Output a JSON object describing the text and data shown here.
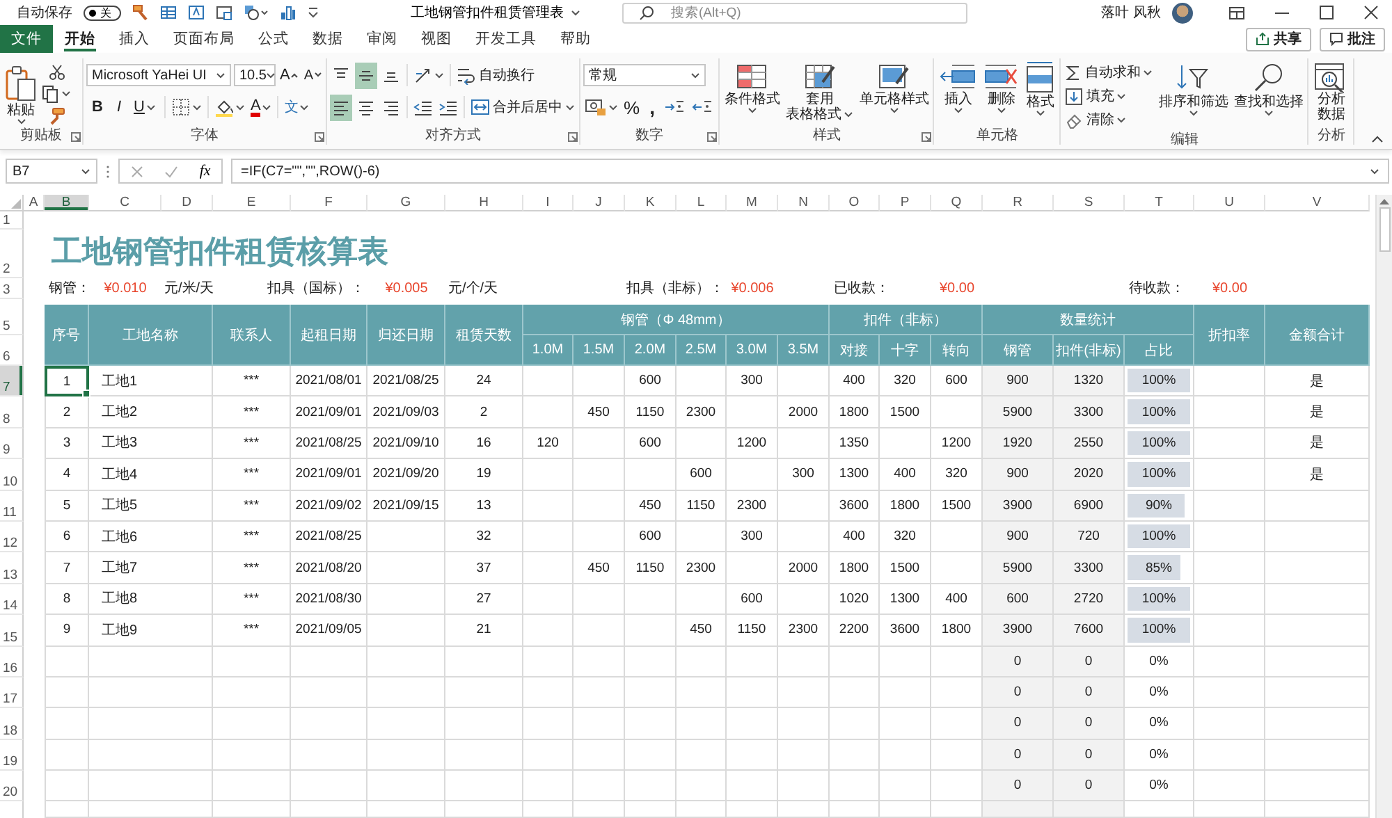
{
  "title_bar": {
    "autosave_label": "自动保存",
    "autosave_toggle": {
      "label": "关",
      "on": false
    },
    "document_title": "工地钢管扣件租赁管理表",
    "search": {
      "placeholder": "搜索(Alt+Q)"
    },
    "user_name": "落叶 风秋"
  },
  "ribbon_tabs": [
    {
      "label": "文件",
      "kind": "file",
      "selected": false
    },
    {
      "label": "开始",
      "kind": "tab",
      "selected": true
    },
    {
      "label": "插入",
      "kind": "tab",
      "selected": false
    },
    {
      "label": "页面布局",
      "kind": "tab",
      "selected": false
    },
    {
      "label": "公式",
      "kind": "tab",
      "selected": false
    },
    {
      "label": "数据",
      "kind": "tab",
      "selected": false
    },
    {
      "label": "审阅",
      "kind": "tab",
      "selected": false
    },
    {
      "label": "视图",
      "kind": "tab",
      "selected": false
    },
    {
      "label": "开发工具",
      "kind": "tab",
      "selected": false
    },
    {
      "label": "帮助",
      "kind": "tab",
      "selected": false
    }
  ],
  "share_button": "共享",
  "comments_button": "批注",
  "ribbon_groups": [
    {
      "kind": "clipboard",
      "label": "剪贴板",
      "dialog_launcher": true,
      "paste": "粘贴"
    },
    {
      "kind": "font",
      "label": "字体",
      "dialog_launcher": true,
      "font_name": "Microsoft YaHei UI",
      "font_size": "10.5",
      "grow_font": "A",
      "shrink_font": "A",
      "bold": "B",
      "italic": "I",
      "underline": "U",
      "font_color": "A",
      "phonetic": "文"
    },
    {
      "kind": "alignment",
      "label": "对齐方式",
      "dialog_launcher": true,
      "vertical_buttons": [
        {
          "selected": false
        },
        {
          "selected": true
        },
        {
          "selected": false
        }
      ],
      "horizontal_buttons": [
        {
          "selected": true
        },
        {
          "selected": false
        },
        {
          "selected": false
        }
      ],
      "wrap_text": "自动换行",
      "merge_center": "合并后居中"
    },
    {
      "kind": "number",
      "label": "数字",
      "dialog_launcher": true,
      "format": "常规",
      "percent": "%",
      "comma": ","
    },
    {
      "kind": "large_buttons",
      "label": "样式",
      "dialog_launcher": true,
      "buttons": [
        {
          "lines": [
            "条件格式"
          ],
          "menu": true
        },
        {
          "lines": [
            "套用",
            "表格格式"
          ],
          "menu": true
        },
        {
          "lines": [
            "单元格样式"
          ],
          "menu": true
        }
      ]
    },
    {
      "kind": "large_buttons",
      "label": "单元格",
      "dialog_launcher": false,
      "buttons": [
        {
          "lines": [
            "插入"
          ],
          "menu": true
        },
        {
          "lines": [
            "删除"
          ],
          "menu": true
        },
        {
          "lines": [
            "格式"
          ],
          "menu": true
        }
      ]
    },
    {
      "kind": "editing",
      "label": "编辑",
      "dialog_launcher": false,
      "small_buttons": [
        {
          "label": "自动求和",
          "menu": true
        },
        {
          "label": "填充",
          "menu": true
        },
        {
          "label": "清除",
          "menu": true
        }
      ],
      "buttons": [
        {
          "lines": [
            "排序和筛选"
          ],
          "menu": true
        },
        {
          "lines": [
            "查找和选择"
          ],
          "menu": true
        }
      ]
    },
    {
      "kind": "large_buttons",
      "label": "分析",
      "dialog_launcher": false,
      "buttons": [
        {
          "lines": [
            "分析",
            "数据"
          ],
          "menu": false
        }
      ]
    }
  ],
  "formula_bar": {
    "name_box": "B7",
    "function_button": "fx",
    "formula": "=IF(C7=\"\",\"\",ROW()-6)"
  },
  "sheet": {
    "column_headers": [
      {
        "label": "A",
        "selected": false
      },
      {
        "label": "B",
        "selected": true
      },
      {
        "label": "C",
        "selected": false
      },
      {
        "label": "D",
        "selected": false
      },
      {
        "label": "E",
        "selected": false
      },
      {
        "label": "F",
        "selected": false
      },
      {
        "label": "G",
        "selected": false
      },
      {
        "label": "H",
        "selected": false
      },
      {
        "label": "I",
        "selected": false
      },
      {
        "label": "J",
        "selected": false
      },
      {
        "label": "K",
        "selected": false
      },
      {
        "label": "L",
        "selected": false
      },
      {
        "label": "M",
        "selected": false
      },
      {
        "label": "N",
        "selected": false
      },
      {
        "label": "O",
        "selected": false
      },
      {
        "label": "P",
        "selected": false
      },
      {
        "label": "Q",
        "selected": false
      },
      {
        "label": "R",
        "selected": false
      },
      {
        "label": "S",
        "selected": false
      },
      {
        "label": "T",
        "selected": false
      },
      {
        "label": "U",
        "selected": false
      },
      {
        "label": "V",
        "selected": false
      }
    ],
    "row_headers": [
      {
        "label": "1",
        "selected": false
      },
      {
        "label": "2",
        "selected": false
      },
      {
        "label": "3",
        "selected": false
      },
      {
        "label": "5",
        "selected": false
      },
      {
        "label": "6",
        "selected": false
      },
      {
        "label": "7",
        "selected": true
      },
      {
        "label": "8",
        "selected": false
      },
      {
        "label": "9",
        "selected": false
      },
      {
        "label": "10",
        "selected": false
      },
      {
        "label": "11",
        "selected": false
      },
      {
        "label": "12",
        "selected": false
      },
      {
        "label": "13",
        "selected": false
      },
      {
        "label": "14",
        "selected": false
      },
      {
        "label": "15",
        "selected": false
      },
      {
        "label": "16",
        "selected": false
      },
      {
        "label": "17",
        "selected": false
      },
      {
        "label": "18",
        "selected": false
      },
      {
        "label": "19",
        "selected": false
      },
      {
        "label": "20",
        "selected": false
      }
    ],
    "title": "工地钢管扣件租赁核算表",
    "rates": [
      {
        "label": "钢管：",
        "value": "¥0.010",
        "unit": "元/米/天"
      },
      {
        "label": "扣具（国标）：",
        "value": "¥0.005",
        "unit": "元/个/天"
      },
      {
        "label": "扣具（非标）：",
        "value": "¥0.006"
      },
      {
        "label": "已收款：",
        "value": "¥0.00"
      },
      {
        "label": "待收款：",
        "value": "¥0.00"
      }
    ],
    "table": {
      "columns": [
        {
          "label": "序号"
        },
        {
          "label": "工地名称"
        },
        {
          "label": "联系人"
        },
        {
          "label": "起租日期"
        },
        {
          "label": "归还日期"
        },
        {
          "label": "租赁天数"
        },
        {
          "label": "1.0M",
          "group": "钢管（Φ 48mm）"
        },
        {
          "label": "1.5M",
          "in_group": true
        },
        {
          "label": "2.0M",
          "in_group": true
        },
        {
          "label": "2.5M",
          "in_group": true
        },
        {
          "label": "3.0M",
          "in_group": true
        },
        {
          "label": "3.5M",
          "in_group": true
        },
        {
          "label": "对接",
          "group": "扣件（非标）"
        },
        {
          "label": "十字",
          "in_group": true
        },
        {
          "label": "转向",
          "in_group": true
        },
        {
          "label": "钢管",
          "group": "数量统计"
        },
        {
          "label": "扣件(非标)",
          "in_group": true
        },
        {
          "label": "占比",
          "in_group": true
        },
        {
          "label": "折扣率"
        },
        {
          "label": "金额合计"
        }
      ],
      "rows": [
        {
          "selected": true,
          "cells": [
            "1",
            "工地1",
            "***",
            "2021/08/01",
            "2021/08/25",
            "24",
            null,
            null,
            "600",
            null,
            "300",
            null,
            "400",
            "320",
            "600",
            "900",
            "1320",
            {
              "text": "100%",
              "level": 1
            },
            null,
            "是"
          ]
        },
        {
          "selected": false,
          "cells": [
            "2",
            "工地2",
            "***",
            "2021/09/01",
            "2021/09/03",
            "2",
            null,
            "450",
            "1150",
            "2300",
            null,
            "2000",
            "1800",
            "1500",
            null,
            "5900",
            "3300",
            {
              "text": "100%",
              "level": 1
            },
            null,
            "是"
          ]
        },
        {
          "selected": false,
          "cells": [
            "3",
            "工地3",
            "***",
            "2021/08/25",
            "2021/09/10",
            "16",
            "120",
            null,
            "600",
            null,
            "1200",
            null,
            "1350",
            null,
            "1200",
            "1920",
            "2550",
            {
              "text": "100%",
              "level": 1
            },
            null,
            "是"
          ]
        },
        {
          "selected": false,
          "cells": [
            "4",
            "工地4",
            "***",
            "2021/09/01",
            "2021/09/20",
            "19",
            null,
            null,
            null,
            "600",
            null,
            "300",
            "1300",
            "400",
            "320",
            "900",
            "2020",
            {
              "text": "100%",
              "level": 1
            },
            null,
            "是"
          ]
        },
        {
          "selected": false,
          "cells": [
            "5",
            "工地5",
            "***",
            "2021/09/02",
            "2021/09/15",
            "13",
            null,
            null,
            "450",
            "1150",
            "2300",
            null,
            "3600",
            "1800",
            "1500",
            "3900",
            "6900",
            {
              "text": "90%",
              "level": 0.9
            },
            null,
            null
          ]
        },
        {
          "selected": false,
          "cells": [
            "6",
            "工地6",
            "***",
            "2021/08/25",
            null,
            "32",
            null,
            null,
            "600",
            null,
            "300",
            null,
            "400",
            "320",
            null,
            "900",
            "720",
            {
              "text": "100%",
              "level": 1
            },
            null,
            null
          ]
        },
        {
          "selected": false,
          "cells": [
            "7",
            "工地7",
            "***",
            "2021/08/20",
            null,
            "37",
            null,
            "450",
            "1150",
            "2300",
            null,
            "2000",
            "1800",
            "1500",
            null,
            "5900",
            "3300",
            {
              "text": "85%",
              "level": 0.85
            },
            null,
            null
          ]
        },
        {
          "selected": false,
          "cells": [
            "8",
            "工地8",
            "***",
            "2021/08/30",
            null,
            "27",
            null,
            null,
            null,
            null,
            "600",
            null,
            "1020",
            "1300",
            "400",
            "600",
            "2720",
            {
              "text": "100%",
              "level": 1
            },
            null,
            null
          ]
        },
        {
          "selected": false,
          "cells": [
            "9",
            "工地9",
            "***",
            "2021/09/05",
            null,
            "21",
            null,
            null,
            null,
            "450",
            "1150",
            "2300",
            "2200",
            "3600",
            "1800",
            "3900",
            "7600",
            {
              "text": "100%",
              "level": 1
            },
            null,
            null
          ]
        },
        {
          "selected": false,
          "cells": [
            null,
            null,
            null,
            null,
            null,
            null,
            null,
            null,
            null,
            null,
            null,
            null,
            null,
            null,
            null,
            "0",
            "0",
            {
              "text": "0%"
            },
            null,
            null
          ]
        },
        {
          "selected": false,
          "cells": [
            null,
            null,
            null,
            null,
            null,
            null,
            null,
            null,
            null,
            null,
            null,
            null,
            null,
            null,
            null,
            "0",
            "0",
            {
              "text": "0%"
            },
            null,
            null
          ]
        },
        {
          "selected": false,
          "cells": [
            null,
            null,
            null,
            null,
            null,
            null,
            null,
            null,
            null,
            null,
            null,
            null,
            null,
            null,
            null,
            "0",
            "0",
            {
              "text": "0%"
            },
            null,
            null
          ]
        },
        {
          "selected": false,
          "cells": [
            null,
            null,
            null,
            null,
            null,
            null,
            null,
            null,
            null,
            null,
            null,
            null,
            null,
            null,
            null,
            "0",
            "0",
            {
              "text": "0%"
            },
            null,
            null
          ]
        },
        {
          "selected": false,
          "cells": [
            null,
            null,
            null,
            null,
            null,
            null,
            null,
            null,
            null,
            null,
            null,
            null,
            null,
            null,
            null,
            "0",
            "0",
            {
              "text": "0%"
            },
            null,
            null
          ]
        }
      ]
    }
  }
}
